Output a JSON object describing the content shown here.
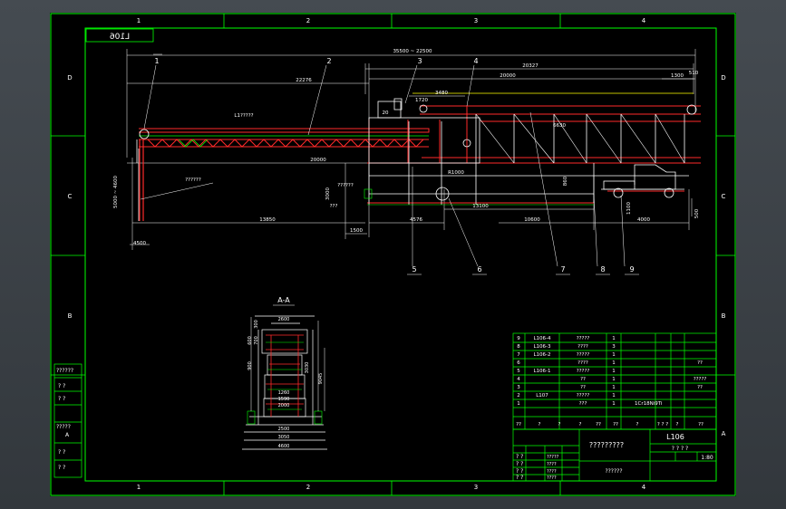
{
  "drawing": {
    "title_box_top": "L106",
    "zones_horizontal": [
      "1",
      "2",
      "3",
      "4"
    ],
    "zones_vertical": [
      "D",
      "C",
      "B",
      "A"
    ],
    "side_labels": [
      "??????",
      "? ?",
      "? ?",
      "?????",
      "A",
      "? ?",
      "? ?"
    ]
  },
  "main_view": {
    "dim_overall": "35500 ~ 22500",
    "dim_right_span": "20327",
    "dim_20000_top": "20000",
    "dim_22276": "22276",
    "dim_3480": "3480",
    "dim_1300": "1300",
    "dim_510": "510",
    "dim_1720": "1720",
    "dim_20": "20",
    "dim_6630": "6630",
    "dim_20000_mid": "20000",
    "dim_3000": "3000",
    "dim_left_vertical": "5000 ~ 4600",
    "dim_13850": "13850",
    "dim_4576": "4576",
    "dim_13100": "13100",
    "dim_10600": "10600",
    "dim_4000": "4000",
    "dim_1500": "1500",
    "dim_4500": "4500",
    "dim_500": "500",
    "dim_1100": "1100",
    "dim_860": "860",
    "dim_r1000": "R1000",
    "note_l": "L1?????",
    "note_2": "??????",
    "note_qq": "???",
    "note_lower_left": "??????",
    "callouts": [
      "1",
      "2",
      "3",
      "4",
      "5",
      "6",
      "7",
      "8",
      "9"
    ]
  },
  "section_view": {
    "title": "A-A",
    "dim_2600": "2600",
    "dim_2500": "2500",
    "dim_3050": "3050",
    "dim_4600": "4600",
    "dim_1260": "1260",
    "dim_1590": "1590",
    "dim_2000": "2000",
    "dim_300": "300",
    "dim_600": "600",
    "dim_700": "700",
    "dim_3030": "3030",
    "dim_900": "900",
    "dim_9045": "9045"
  },
  "bom": {
    "rows": [
      {
        "no": "9",
        "code": "L106-4",
        "name": "?????",
        "qty": "1",
        "note": ""
      },
      {
        "no": "8",
        "code": "L106-3",
        "name": "????",
        "qty": "3",
        "note": ""
      },
      {
        "no": "7",
        "code": "L106-2",
        "name": "?????",
        "qty": "1",
        "note": ""
      },
      {
        "no": "6",
        "code": "",
        "name": "????",
        "qty": "1",
        "note": "??"
      },
      {
        "no": "5",
        "code": "L106-1",
        "name": "?????",
        "qty": "1",
        "note": ""
      },
      {
        "no": "4",
        "code": "",
        "name": "??",
        "qty": "1",
        "note": "?????"
      },
      {
        "no": "3",
        "code": "",
        "name": "??",
        "qty": "1",
        "note": "??"
      },
      {
        "no": "2",
        "code": "L107",
        "name": "?????",
        "qty": "1",
        "note": ""
      },
      {
        "no": "1",
        "code": "",
        "name": "???",
        "qty": "1",
        "note": "1Cr18Ni9Ti"
      }
    ],
    "header": [
      "??",
      "?",
      "?",
      "?",
      "??",
      "??",
      "?",
      "? ? ?",
      "?",
      "??"
    ]
  },
  "title_block": {
    "drawing_no": "L106",
    "title": "?????????",
    "company": "??????",
    "scale": "1:80",
    "sheet_info": "? ? ? ?",
    "row_labels": [
      "? ?",
      "? ?",
      "? ?",
      "? ?"
    ],
    "mid_labels": [
      "?????",
      "????",
      "????",
      "????"
    ]
  }
}
